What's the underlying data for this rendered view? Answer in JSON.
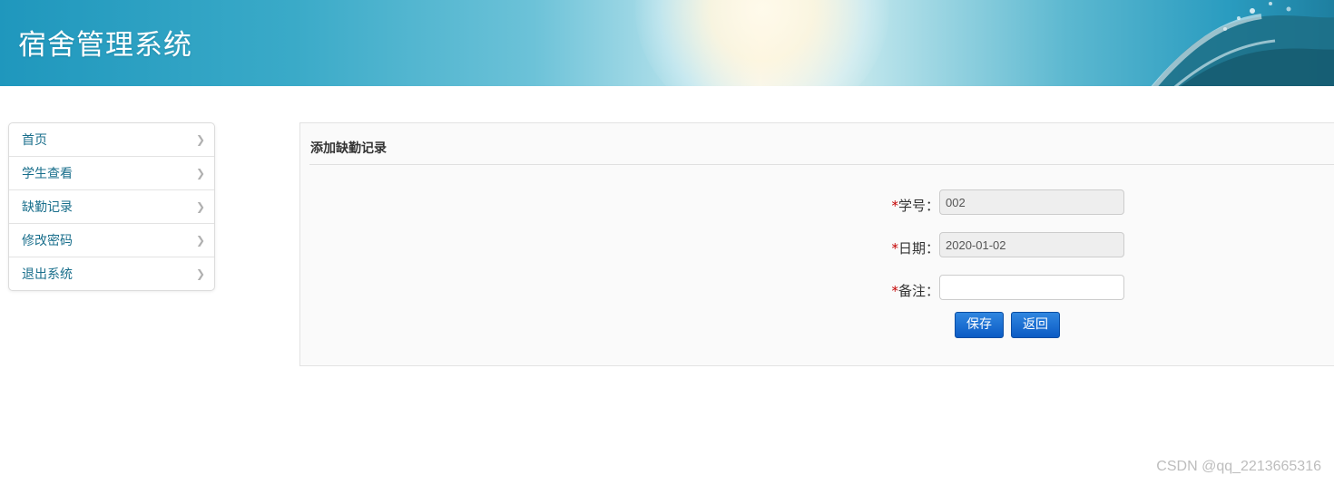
{
  "header": {
    "title": "宿舍管理系统"
  },
  "sidebar": {
    "items": [
      {
        "label": "首页"
      },
      {
        "label": "学生查看"
      },
      {
        "label": "缺勤记录"
      },
      {
        "label": "修改密码"
      },
      {
        "label": "退出系统"
      }
    ]
  },
  "panel": {
    "title": "添加缺勤记录",
    "fields": {
      "student_id": {
        "required_mark": "*",
        "label": "学号：",
        "value": "002"
      },
      "date": {
        "required_mark": "*",
        "label": "日期：",
        "value": "2020-01-02"
      },
      "note": {
        "required_mark": "*",
        "label": "备注：",
        "value": ""
      }
    },
    "buttons": {
      "save": "保存",
      "back": "返回"
    }
  },
  "watermark": "CSDN @qq_2213665316",
  "colors": {
    "nav_text": "#1a6f8c",
    "button_blue": "#0b5bc4",
    "required_red": "#c40000"
  }
}
